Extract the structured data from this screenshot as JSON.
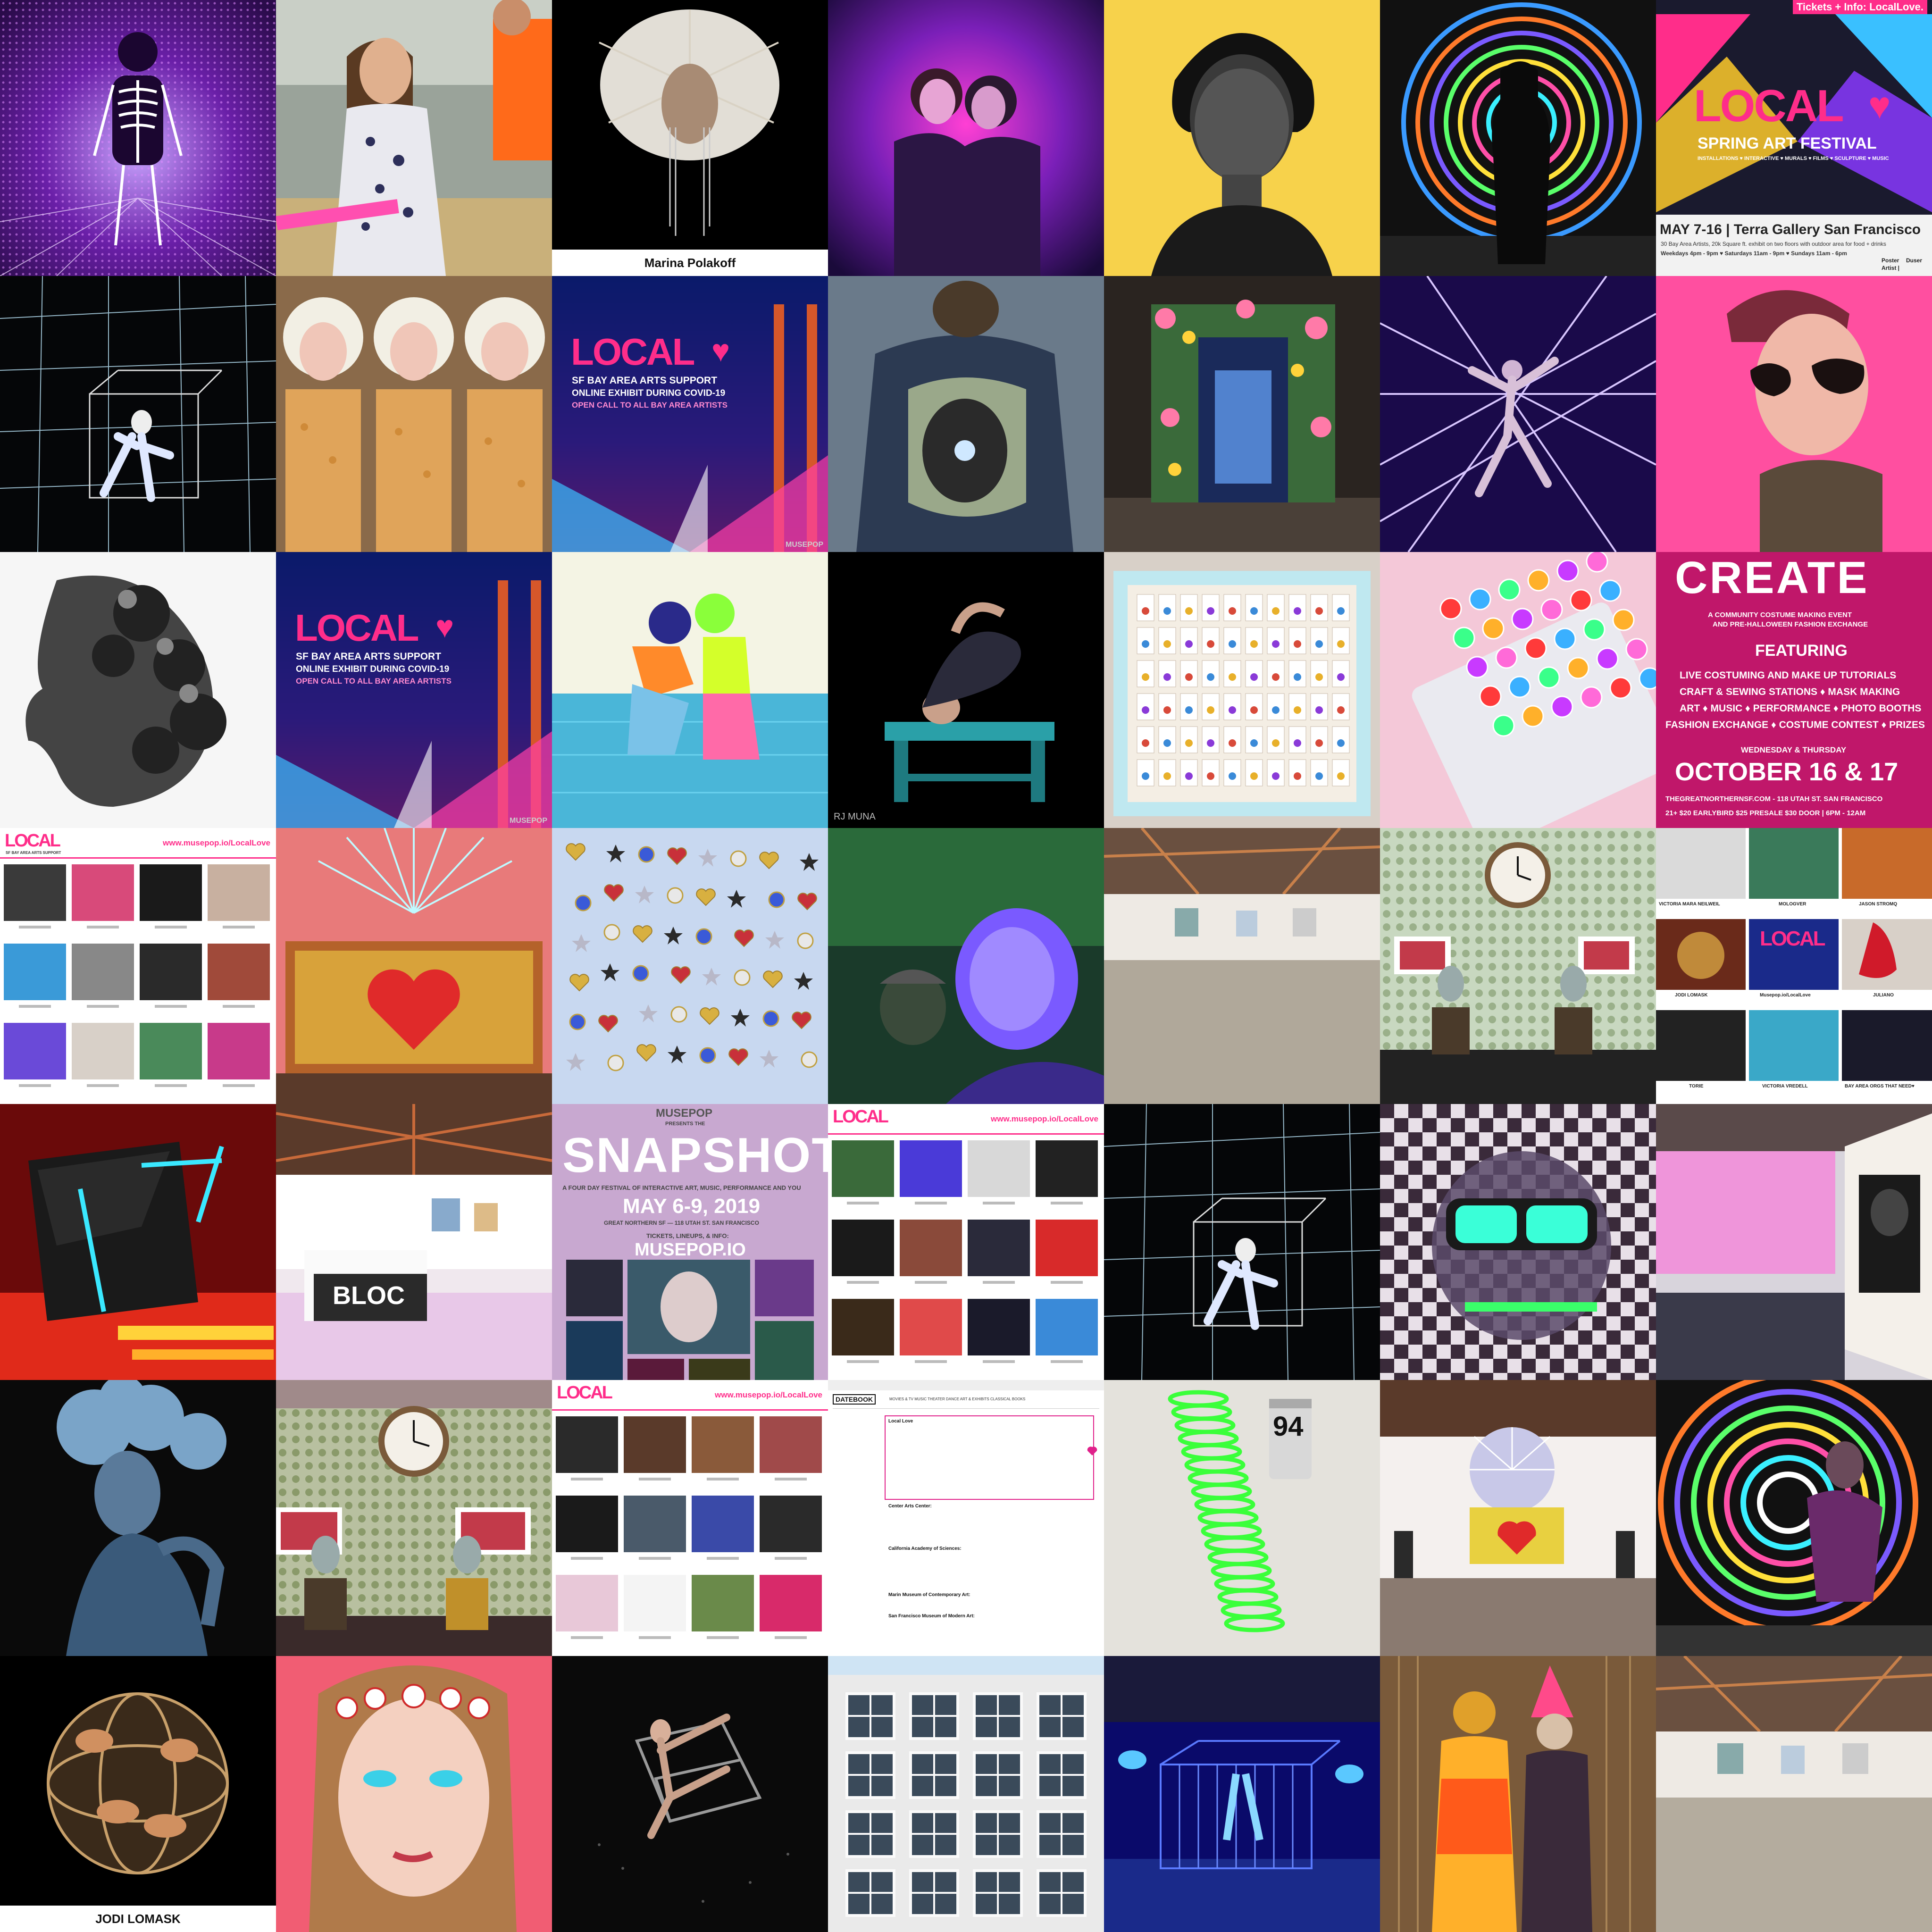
{
  "tiles": {
    "r0c2_caption": "Marina Polakoff",
    "r0c6": {
      "top_banner": "Tickets + Info: LocalLove.",
      "logo": "LOCAL",
      "subtitle": "SPRING ART FESTIVAL",
      "tags": "INSTALLATIONS ♥ INTERACTIVE ♥ MURALS ♥ FILMS ♥ SCULPTURE ♥ MUSIC",
      "dates": "MAY 7-16 | Terra Gallery San Francisco",
      "line1": "30 Bay Area Artists, 20k Square ft. exhibit on two floors with outdoor area for food + drinks",
      "hours": "Weekdays 4pm - 9pm ♥ Saturdays 11am - 9pm ♥ Sundays 11am - 6pm",
      "credit1": "Poster",
      "credit2": "Artist |",
      "credit3": "Duser"
    },
    "local_poster": {
      "logo": "LOCAL",
      "line1": "SF BAY AREA ARTS SUPPORT",
      "line2": "ONLINE EXHIBIT DURING COVID-19",
      "line3": "OPEN CALL TO ALL BAY AREA ARTISTS",
      "mark": "MUSEPOP"
    },
    "r2c3_credit": "RJ MUNA",
    "r2c6": {
      "title": "CREATE",
      "sub1": "A COMMUNITY COSTUME MAKING EVENT",
      "sub2": "AND PRE-HALLOWEEN FASHION EXCHANGE",
      "featuring": "FEATURING",
      "f1": "LIVE COSTUMING AND MAKE UP TUTORIALS",
      "f2": "CRAFT & SEWING STATIONS ♦ MASK MAKING",
      "f3": "ART ♦ MUSIC ♦ PERFORMANCE ♦ PHOTO BOOTHS",
      "f4": "FASHION EXCHANGE ♦ COSTUME CONTEST ♦ PRIZES",
      "when": "WEDNESDAY & THURSDAY",
      "date": "OCTOBER 16 & 17",
      "venue": "THEGREATNORTHERNSF.COM - 118 UTAH ST. SAN FRANCISCO",
      "price": "21+ $20 EARLYBIRD $25 PRESALE $30 DOOR | 6PM - 12AM"
    },
    "r3c0": {
      "logo": "LOCAL",
      "tag": "SF BAY AREA ARTS SUPPORT",
      "url": "www.musepop.io/LocalLove"
    },
    "r3c6": {
      "n1": "VICTORIA MARA NEILWEIL",
      "n2": "MOLOGVER",
      "n3": "JASON STROMQ",
      "n4": "JODI LOMASK",
      "n5": "Musepop.io/LocalLove",
      "n6": "JULIANO",
      "n7": "TORIE",
      "n8": "VICTORIA VREDELL",
      "n9": "BAY AREA ORGS THAT NEED♥",
      "logo": "LOCAL"
    },
    "r4c1_sign": "BLOC",
    "r4c2": {
      "mark": "MUSEPOP",
      "presents": "PRESENTS THE",
      "title": "SNAPSHOT",
      "tagline": "A FOUR DAY FESTIVAL OF INTERACTIVE ART, MUSIC, PERFORMANCE AND YOU",
      "dates": "MAY 6-9, 2019",
      "venue": "GREAT NORTHERN SF — 118 UTAH ST. SAN FRANCISCO",
      "tickets": "TICKETS, LINEUPS, & INFO:",
      "site": "MUSEPOP.IO"
    },
    "r4c3": {
      "logo": "LOCAL",
      "url": "www.musepop.io/LocalLove"
    },
    "r5c2": {
      "logo": "LOCAL",
      "url": "www.musepop.io/LocalLove"
    },
    "r5c3": {
      "brand": "DATEBOOK",
      "nav": "MOVIES & TV    MUSIC    THEATER    DANCE    ART & EXHIBITS    CLASSICAL    BOOKS",
      "lead": "Local Love",
      "p2": "Center Arts Center:",
      "p3": "California Academy of Sciences:",
      "p4": "Marin Museum of Contemporary Art:",
      "p5": "San Francisco Museum of Modern Art:"
    },
    "r5c4_can": "94",
    "r6c0_caption": "JODI LOMASK"
  }
}
